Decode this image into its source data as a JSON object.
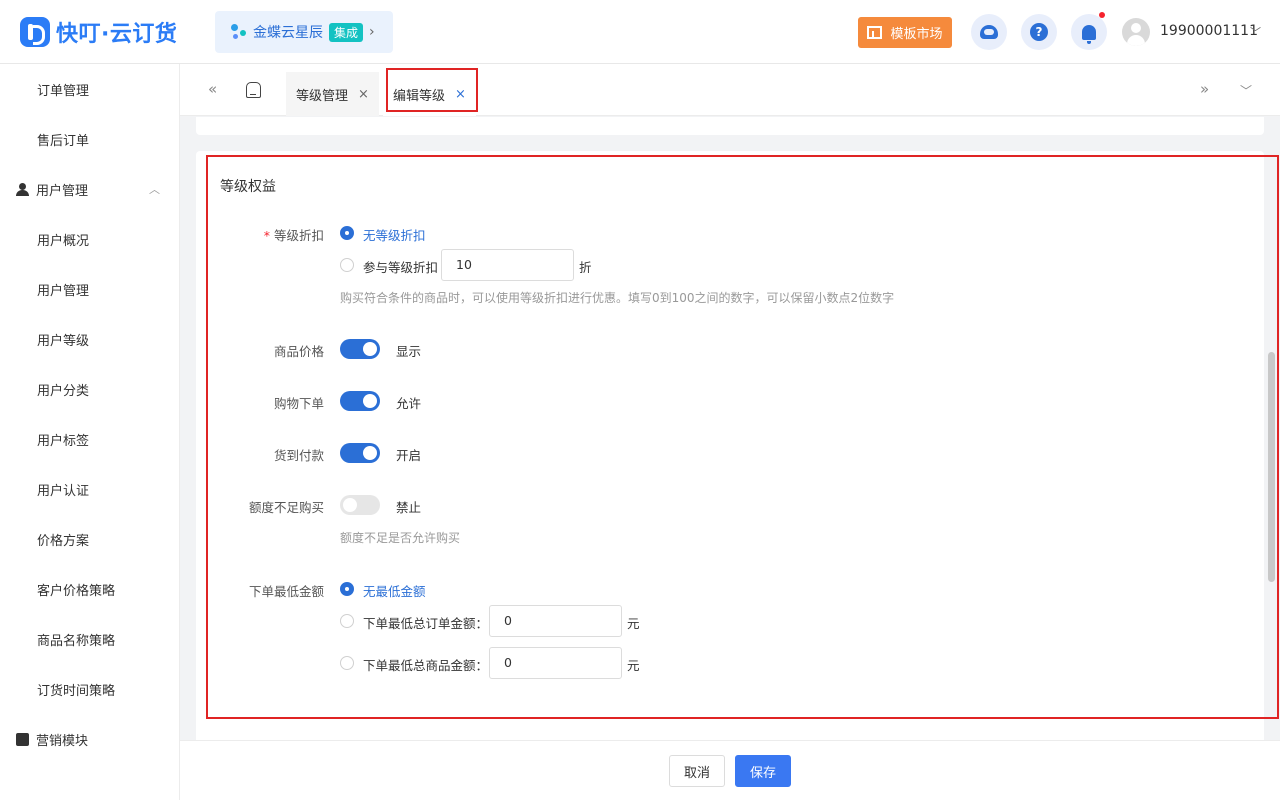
{
  "header": {
    "logo_text": "快叮·云订货",
    "product_badge": {
      "name": "金蝶云星辰",
      "tag": "集成",
      "arrow": "›"
    },
    "template_market": "模板市场",
    "help_glyph": "?",
    "username": "19900001111",
    "user_menu_arrow": "﹀"
  },
  "sidebar": {
    "items": [
      {
        "label": "订单管理",
        "type": "sub"
      },
      {
        "label": "售后订单",
        "type": "sub"
      },
      {
        "label": "用户管理",
        "type": "group",
        "arrow": "︿"
      },
      {
        "label": "用户概况",
        "type": "sub"
      },
      {
        "label": "用户管理",
        "type": "sub"
      },
      {
        "label": "用户等级",
        "type": "sub"
      },
      {
        "label": "用户分类",
        "type": "sub"
      },
      {
        "label": "用户标签",
        "type": "sub"
      },
      {
        "label": "用户认证",
        "type": "sub"
      },
      {
        "label": "价格方案",
        "type": "sub"
      },
      {
        "label": "客户价格策略",
        "type": "sub"
      },
      {
        "label": "商品名称策略",
        "type": "sub"
      },
      {
        "label": "订货时间策略",
        "type": "sub"
      },
      {
        "label": "营销模块",
        "type": "group"
      }
    ]
  },
  "tabs": {
    "prev_glyph": "«",
    "next_glyph": "»",
    "more_glyph": "﹀",
    "close_glyph": "×",
    "items": [
      {
        "label": "等级管理",
        "active": false
      },
      {
        "label": "编辑等级",
        "active": true
      }
    ]
  },
  "section": {
    "title": "等级权益",
    "discount": {
      "label": "等级折扣",
      "required_mark": "*",
      "option_none": "无等级折扣",
      "option_join": "参与等级折扣",
      "value": "10",
      "unit": "折",
      "hint": "购买符合条件的商品时，可以使用等级折扣进行优惠。填写0到100之间的数字，可以保留小数点2位数字",
      "selected": "none"
    },
    "price": {
      "label": "商品价格",
      "on": true,
      "state_text": "显示"
    },
    "order": {
      "label": "购物下单",
      "on": true,
      "state_text": "允许"
    },
    "cod": {
      "label": "货到付款",
      "on": true,
      "state_text": "开启"
    },
    "credit": {
      "label": "额度不足购买",
      "on": false,
      "state_text": "禁止",
      "hint": "额度不足是否允许购买"
    },
    "min_amount": {
      "label": "下单最低金额",
      "option_none": "无最低金额",
      "option_order_total": "下单最低总订单金额：",
      "order_total_value": "0",
      "option_goods_total": "下单最低总商品金额：",
      "goods_total_value": "0",
      "unit": "元",
      "selected": "none"
    }
  },
  "footer": {
    "cancel_label": "取消",
    "save_label": "保存"
  },
  "colors": {
    "primary": "#2b6fd6",
    "accent_orange": "#f58a3c",
    "highlight": "#e02424",
    "tag_teal": "#13c2c2"
  }
}
